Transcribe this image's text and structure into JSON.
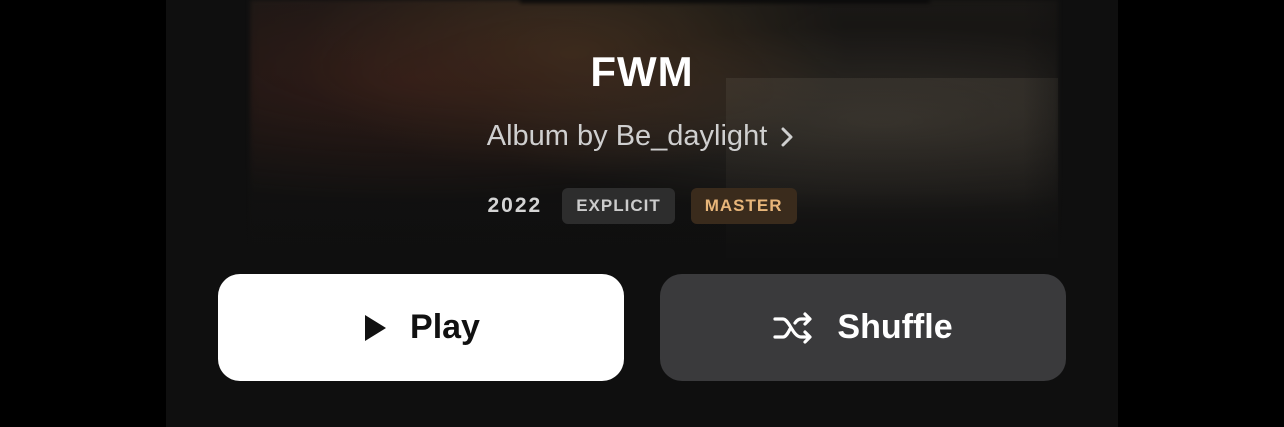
{
  "album": {
    "title": "FWM",
    "artist_line": "Album by Be_daylight",
    "year": "2022",
    "badges": {
      "explicit": "EXPLICIT",
      "master": "MASTER"
    }
  },
  "actions": {
    "play_label": "Play",
    "shuffle_label": "Shuffle"
  },
  "icons": {
    "artist_link": "chevron-right-icon",
    "play": "play-icon",
    "shuffle": "shuffle-icon"
  },
  "colors": {
    "background": "#0f0f0f",
    "play_button": "#ffffff",
    "shuffle_button": "#3a3a3c",
    "explicit_badge": "#2d2d2d",
    "master_badge": "#3a2b1c",
    "master_text": "#e8b67a"
  }
}
